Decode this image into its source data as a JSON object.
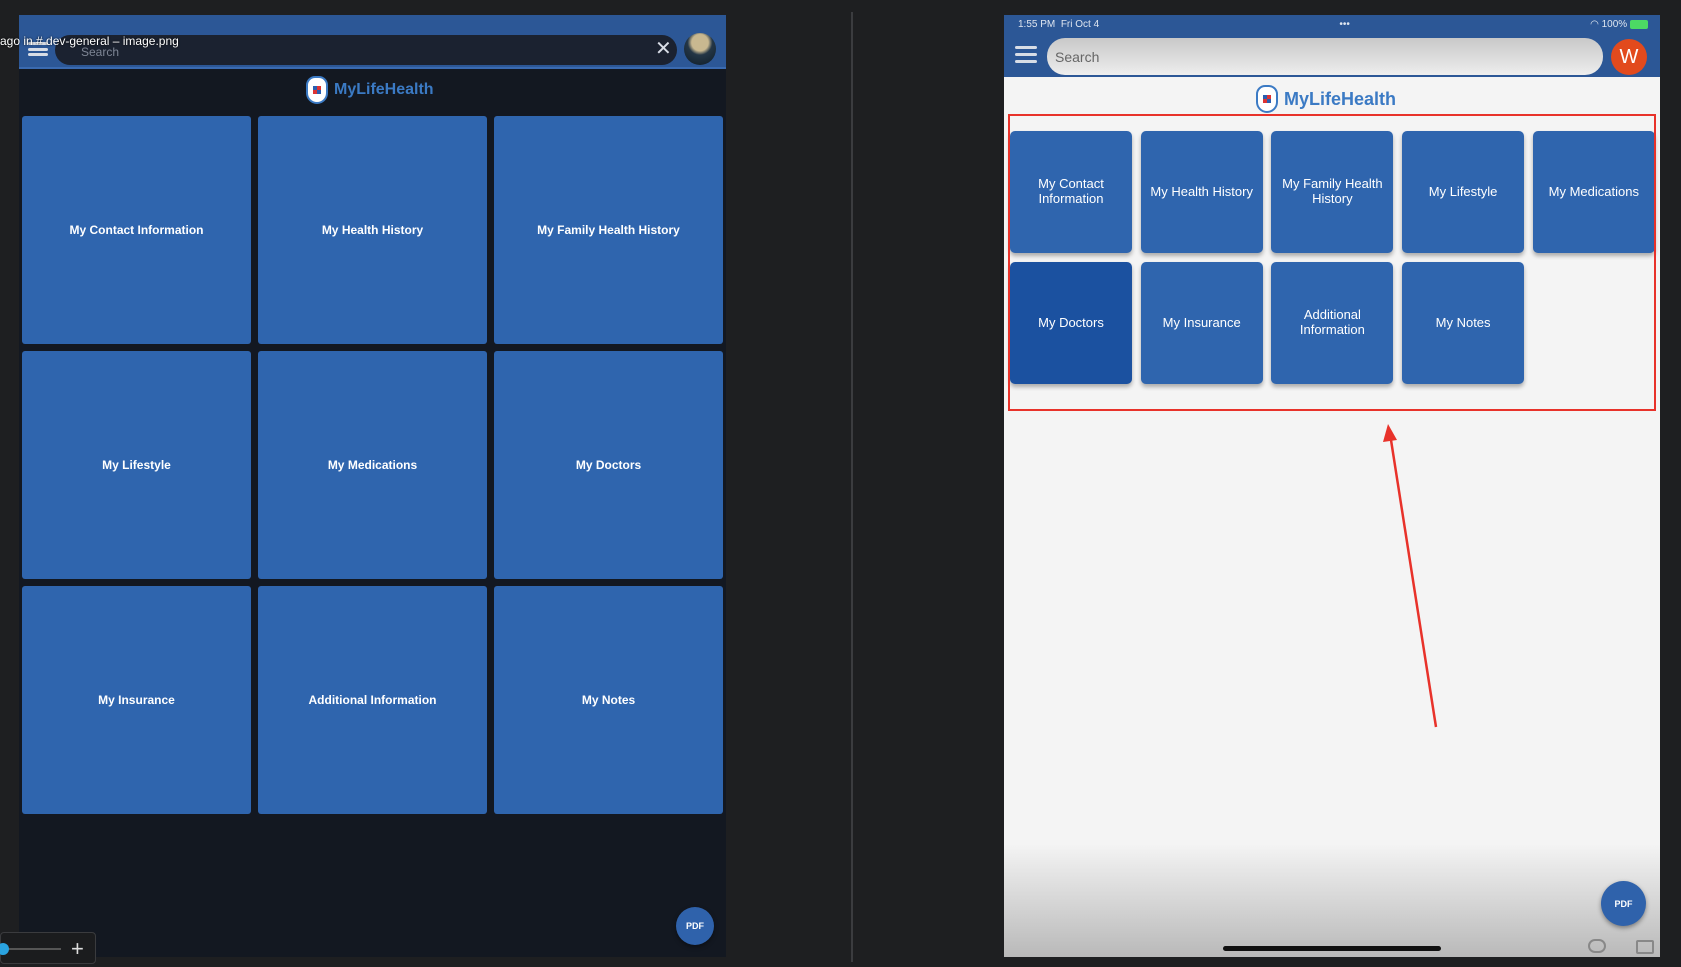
{
  "caption": "ago in # dev-general  – image.png",
  "left_app": {
    "search_placeholder": "Search",
    "close": "✕",
    "brand": "MyLifeHealth",
    "tiles": [
      "My Contact Information",
      "My Health History",
      "My Family Health History",
      "My Lifestyle",
      "My Medications",
      "My Doctors",
      "My Insurance",
      "Additional Information",
      "My Notes"
    ],
    "pdf": "PDF"
  },
  "right_app": {
    "status_time": "1:55 PM",
    "status_date": "Fri Oct 4",
    "status_dots": "•••",
    "status_battery": "100%",
    "search_placeholder": "Search",
    "avatar_letter": "W",
    "brand": "MyLifeHealth",
    "tiles": [
      "My Contact Information",
      "My Health History",
      "My Family Health History",
      "My Lifestyle",
      "My Medications",
      "My Doctors",
      "My Insurance",
      "Additional Information",
      "My Notes"
    ],
    "selected_tile": "My Doctors",
    "pdf": "PDF"
  },
  "zoom_control": {
    "plus": "+"
  },
  "colors": {
    "tile": "#2f65ae",
    "header": "#2c5796",
    "highlight": "#e8322a",
    "avatar": "#e24a1d"
  }
}
